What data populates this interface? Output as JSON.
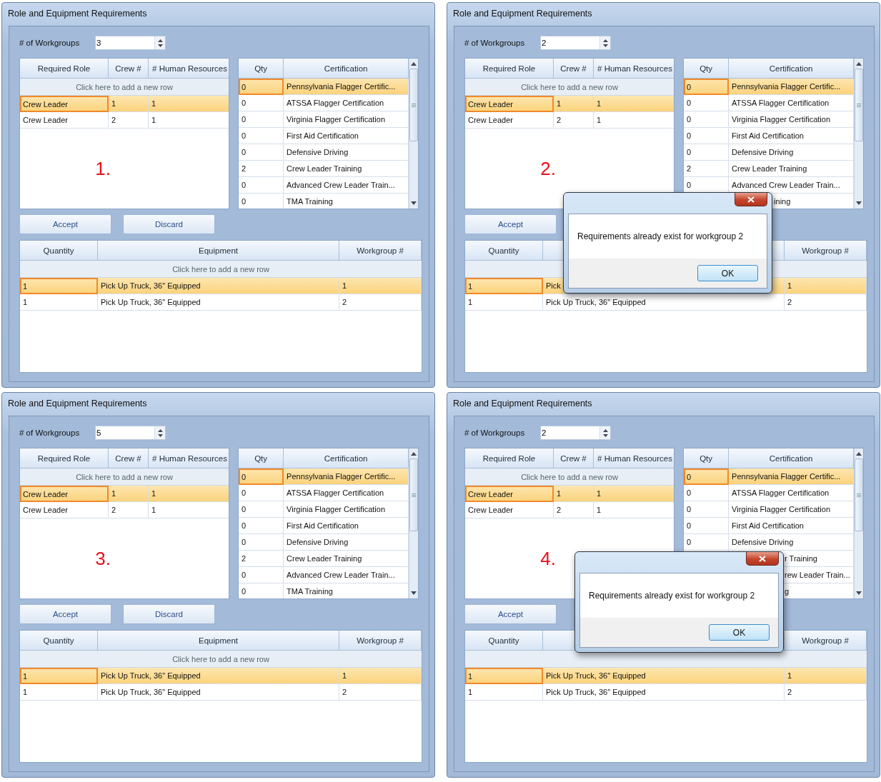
{
  "panels": [
    {
      "label": "1.",
      "window": {
        "title": "Role and Equipment Requirements"
      },
      "workgroups": {
        "label": "# of Workgroups",
        "value": "3"
      },
      "roles": {
        "columns": [
          "Required Role",
          "Crew #",
          "# Human Resources"
        ],
        "add_row_hint": "Click here to add a new row",
        "rows": [
          {
            "cells": [
              "Crew Leader",
              "1",
              "1"
            ],
            "selected": true
          },
          {
            "cells": [
              "Crew Leader",
              "2",
              "1"
            ],
            "selected": false
          }
        ]
      },
      "certifications": {
        "columns": [
          "Qty",
          "Certification"
        ],
        "rows": [
          {
            "qty": "0",
            "name": "Pennsylvania Flagger Certific...",
            "selected": true
          },
          {
            "qty": "0",
            "name": "ATSSA Flagger Certification",
            "selected": false
          },
          {
            "qty": "0",
            "name": "Virginia Flagger Certification",
            "selected": false
          },
          {
            "qty": "0",
            "name": "First Aid Certification",
            "selected": false
          },
          {
            "qty": "0",
            "name": "Defensive Driving",
            "selected": false
          },
          {
            "qty": "2",
            "name": "Crew Leader Training",
            "selected": false
          },
          {
            "qty": "0",
            "name": "Advanced Crew Leader Train...",
            "selected": false
          },
          {
            "qty": "0",
            "name": "TMA Training",
            "selected": false
          }
        ]
      },
      "buttons": [
        {
          "label": "Accept"
        },
        {
          "label": "Discard"
        }
      ],
      "equipment": {
        "columns": [
          "Quantity",
          "Equipment",
          "Workgroup #"
        ],
        "add_row_hint": "Click here to add a new row",
        "rows": [
          {
            "cells": [
              "1",
              "Pick Up Truck, 36\" Equipped",
              "1"
            ],
            "selected": true
          },
          {
            "cells": [
              "1",
              "Pick Up Truck, 36\" Equipped",
              "2"
            ],
            "selected": false
          }
        ]
      }
    },
    {
      "label": "2.",
      "window": {
        "title": "Role and Equipment Requirements"
      },
      "workgroups": {
        "label": "# of Workgroups",
        "value": "2"
      },
      "roles": {
        "columns": [
          "Required Role",
          "Crew #",
          "# Human Resources"
        ],
        "add_row_hint": "Click here to add a new row",
        "rows": [
          {
            "cells": [
              "Crew Leader",
              "1",
              "1"
            ],
            "selected": true
          },
          {
            "cells": [
              "Crew Leader",
              "2",
              "1"
            ],
            "selected": false
          }
        ]
      },
      "certifications": {
        "columns": [
          "Qty",
          "Certification"
        ],
        "rows": [
          {
            "qty": "0",
            "name": "Pennsylvania Flagger Certific...",
            "selected": true
          },
          {
            "qty": "0",
            "name": "ATSSA Flagger Certification",
            "selected": false
          },
          {
            "qty": "0",
            "name": "Virginia Flagger Certification",
            "selected": false
          },
          {
            "qty": "0",
            "name": "First Aid Certification",
            "selected": false
          },
          {
            "qty": "0",
            "name": "Defensive Driving",
            "selected": false
          },
          {
            "qty": "2",
            "name": "Crew Leader Training",
            "selected": false
          },
          {
            "qty": "0",
            "name": "Advanced Crew Leader Train...",
            "selected": false
          },
          {
            "name": "ining",
            "cut": true,
            "selected": false
          }
        ]
      },
      "buttons": [
        {
          "label": "Accept"
        }
      ],
      "equipment": {
        "columns": [
          "Quantity",
          null,
          "Workgroup #"
        ],
        "rows": [
          {
            "cells": [
              "1",
              "Pick",
              "1"
            ],
            "selected": true
          },
          {
            "cells": [
              "1",
              "Pick Up Truck, 36\" Equipped",
              "2"
            ],
            "selected": false
          }
        ]
      },
      "dialog": {
        "message": "Requirements already exist for workgroup 2",
        "button": "OK"
      }
    },
    {
      "label": "3.",
      "window": {
        "title": "Role and Equipment Requirements"
      },
      "workgroups": {
        "label": "# of Workgroups",
        "value": "5"
      },
      "roles": {
        "columns": [
          "Required Role",
          "Crew #",
          "# Human Resources"
        ],
        "add_row_hint": "Click here to add a new row",
        "rows": [
          {
            "cells": [
              "Crew Leader",
              "1",
              "1"
            ],
            "selected": true
          },
          {
            "cells": [
              "Crew Leader",
              "2",
              "1"
            ],
            "selected": false
          }
        ]
      },
      "certifications": {
        "columns": [
          "Qty",
          "Certification"
        ],
        "rows": [
          {
            "qty": "0",
            "name": "Pennsylvania Flagger Certific...",
            "selected": true
          },
          {
            "qty": "0",
            "name": "ATSSA Flagger Certification",
            "selected": false
          },
          {
            "qty": "0",
            "name": "Virginia Flagger Certification",
            "selected": false
          },
          {
            "qty": "0",
            "name": "First Aid Certification",
            "selected": false
          },
          {
            "qty": "0",
            "name": "Defensive Driving",
            "selected": false
          },
          {
            "qty": "2",
            "name": "Crew Leader Training",
            "selected": false
          },
          {
            "qty": "0",
            "name": "Advanced Crew Leader Train...",
            "selected": false
          },
          {
            "qty": "0",
            "name": "TMA Training",
            "selected": false
          }
        ]
      },
      "buttons": [
        {
          "label": "Accept"
        },
        {
          "label": "Discard"
        }
      ],
      "equipment": {
        "columns": [
          "Quantity",
          "Equipment",
          "Workgroup #"
        ],
        "add_row_hint": "Click here to add a new row",
        "rows": [
          {
            "cells": [
              "1",
              "Pick Up Truck, 36\" Equipped",
              "1"
            ],
            "selected": true
          },
          {
            "cells": [
              "1",
              "Pick Up Truck, 36\" Equipped",
              "2"
            ],
            "selected": false
          }
        ]
      }
    },
    {
      "label": "4.",
      "window": {
        "title": "Role and Equipment Requirements"
      },
      "workgroups": {
        "label": "# of Workgroups",
        "value": "2"
      },
      "roles": {
        "columns": [
          "Required Role",
          "Crew #",
          "# Human Resources"
        ],
        "add_row_hint": "Click here to add a new row",
        "rows": [
          {
            "cells": [
              "Crew Leader",
              "1",
              "1"
            ],
            "selected": true
          },
          {
            "cells": [
              "Crew Leader",
              "2",
              "1"
            ],
            "selected": false
          }
        ]
      },
      "certifications": {
        "columns": [
          "Qty",
          "Certification"
        ],
        "rows": [
          {
            "qty": "0",
            "name": "Pennsylvania Flagger Certific...",
            "selected": true
          },
          {
            "qty": "0",
            "name": "ATSSA Flagger Certification",
            "selected": false
          },
          {
            "qty": "0",
            "name": "Virginia Flagger Certification",
            "selected": false
          },
          {
            "qty": "0",
            "name": "First Aid Certification",
            "selected": false
          },
          {
            "qty": "0",
            "name": "Defensive Driving",
            "selected": false
          },
          {
            "name": "r Training",
            "cut": true,
            "selected": false
          },
          {
            "name": "rew Leader Train...",
            "cut": true,
            "selected": false
          },
          {
            "name": "g",
            "cut": true,
            "selected": false
          }
        ]
      },
      "buttons": [
        {
          "label": "Accept"
        }
      ],
      "equipment": {
        "columns": [
          "Quantity",
          null,
          "Workgroup #"
        ],
        "rows": [
          {
            "cells": [
              "1",
              "Pick Up Truck, 36\" Equipped",
              "1"
            ],
            "selected": true
          },
          {
            "cells": [
              "1",
              "Pick Up Truck, 36\" Equipped",
              "2"
            ],
            "selected": false
          }
        ]
      },
      "dialog": {
        "message": "Requirements already exist for workgroup 2",
        "button": "OK"
      }
    }
  ]
}
